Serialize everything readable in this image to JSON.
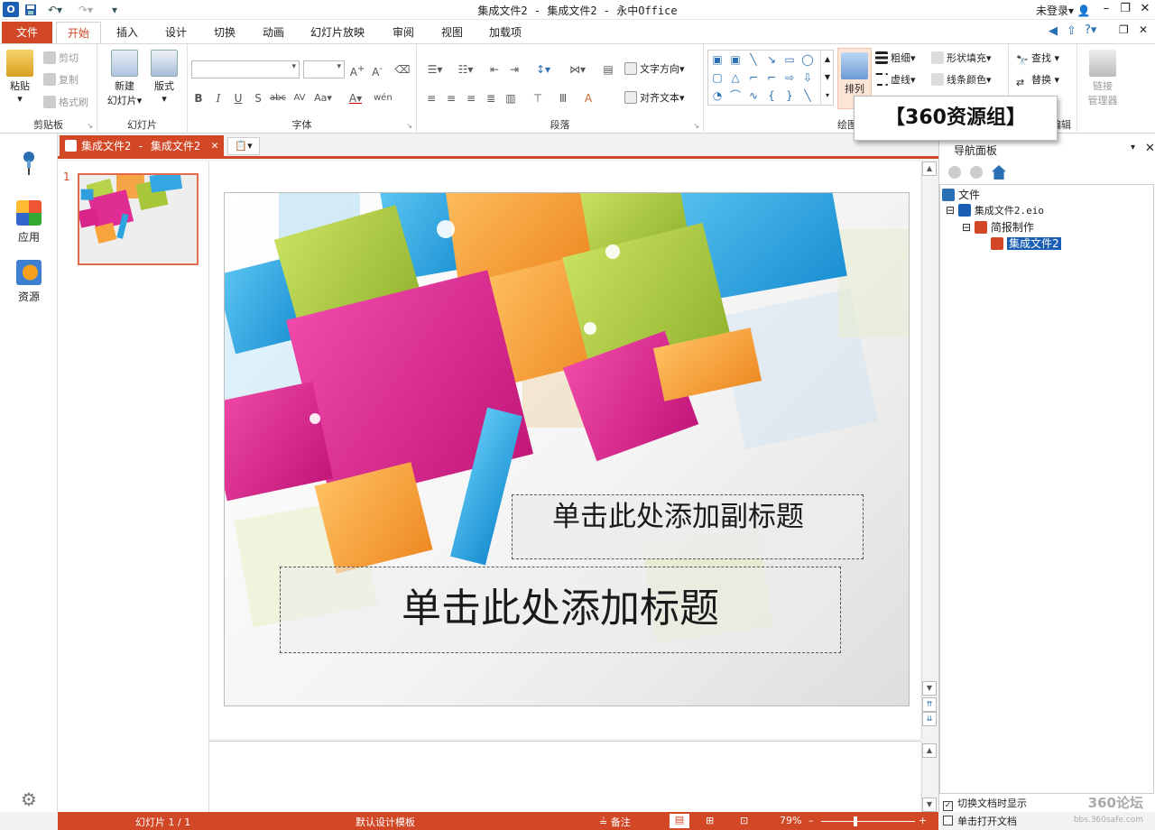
{
  "window": {
    "title": "集成文件2 - 集成文件2 - 永中Office",
    "login": "未登录"
  },
  "tabs": [
    {
      "label": "文件"
    },
    {
      "label": "开始"
    },
    {
      "label": "插入"
    },
    {
      "label": "设计"
    },
    {
      "label": "切换"
    },
    {
      "label": "动画"
    },
    {
      "label": "幻灯片放映"
    },
    {
      "label": "审阅"
    },
    {
      "label": "视图"
    },
    {
      "label": "加载项"
    }
  ],
  "ribbon": {
    "clipboard": {
      "label": "剪贴板",
      "paste": "粘贴",
      "cut": "剪切",
      "copy": "复制",
      "format_painter": "格式刷"
    },
    "slides": {
      "label": "幻灯片",
      "new_slide_1": "新建",
      "new_slide_2": "幻灯片",
      "layout": "版式"
    },
    "font": {
      "label": "字体"
    },
    "paragraph": {
      "label": "段落",
      "text_direction": "文字方向",
      "align_text": "对齐文本"
    },
    "drawing": {
      "label": "绘图",
      "arrange": "排列",
      "weight": "粗细",
      "dash": "虚线",
      "shape_fill": "形状填充",
      "line_color": "线条颜色"
    },
    "editing": {
      "label": "编辑",
      "find": "查找",
      "replace": "替换"
    },
    "link": {
      "line1": "链接",
      "line2": "管理器"
    }
  },
  "left_rail": {
    "apps": "应用",
    "resources": "资源"
  },
  "doc_tab": {
    "title": "集成文件2 - 集成文件2"
  },
  "thumbnails": {
    "number": "1"
  },
  "slide": {
    "subtitle": "单击此处添加副标题",
    "title": "单击此处添加标题"
  },
  "nav_pane": {
    "title": "导航面板",
    "tree": {
      "root": "文件",
      "file": "集成文件2.eio",
      "group": "简报制作",
      "doc": "集成文件2"
    },
    "opt_show_on_switch": "切换文档时显示",
    "opt_single_click": "单击打开文档"
  },
  "status": {
    "slide_pos": "幻灯片 1 / 1",
    "template": "默认设计模板",
    "notes": "备注",
    "zoom": "79%"
  },
  "watermark": {
    "text": "【360资源组】",
    "corner": "360论坛",
    "corner_sub": "bbs.360safe.com"
  },
  "colors": {
    "accent": "#d24726",
    "title_blue": "#1a5fb4"
  }
}
